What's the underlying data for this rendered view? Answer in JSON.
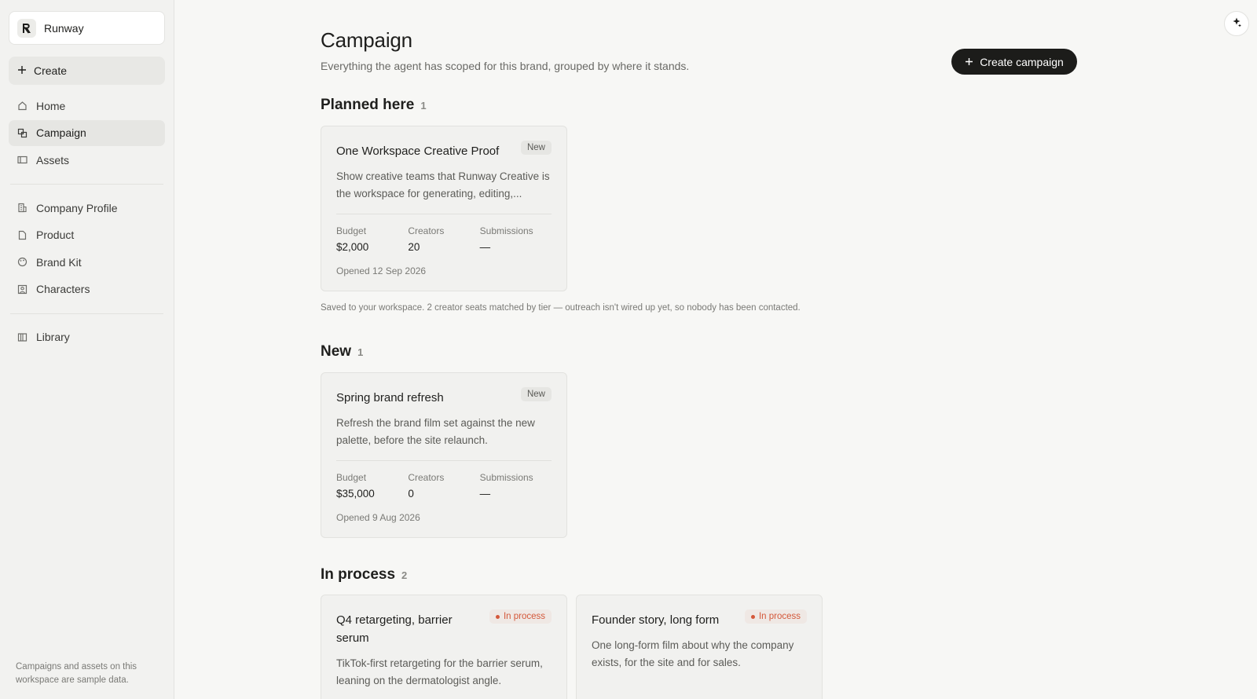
{
  "workspace": {
    "name": "Runway"
  },
  "sidebar": {
    "create_label": "Create",
    "nav_main": [
      {
        "label": "Home",
        "icon": "home-icon",
        "active": false
      },
      {
        "label": "Campaign",
        "icon": "campaign-icon",
        "active": true
      },
      {
        "label": "Assets",
        "icon": "assets-icon",
        "active": false
      }
    ],
    "nav_brand": [
      {
        "label": "Company Profile",
        "icon": "company-icon"
      },
      {
        "label": "Product",
        "icon": "product-icon"
      },
      {
        "label": "Brand Kit",
        "icon": "palette-icon"
      },
      {
        "label": "Characters",
        "icon": "character-icon"
      }
    ],
    "nav_library": [
      {
        "label": "Library",
        "icon": "library-icon"
      }
    ],
    "note": "Campaigns and assets on this workspace are sample data."
  },
  "header": {
    "title": "Campaign",
    "subtitle": "Everything the agent has scoped for this brand, grouped by where it stands.",
    "create_button": "Create campaign"
  },
  "sections": {
    "planned": {
      "title": "Planned here",
      "count": "1",
      "footnote": "Saved to your workspace. 2 creator seats matched by tier — outreach isn't wired up yet, so nobody has been contacted."
    },
    "new": {
      "title": "New",
      "count": "1"
    },
    "in_process": {
      "title": "In process",
      "count": "2"
    }
  },
  "cards": {
    "planned_0": {
      "title": "One Workspace Creative Proof",
      "badge": "New",
      "desc": "Show creative teams that Runway Creative is the workspace for generating, editing,...",
      "budget_label": "Budget",
      "budget": "$2,000",
      "creators_label": "Creators",
      "creators": "20",
      "submissions_label": "Submissions",
      "submissions": "—",
      "opened": "Opened 12 Sep 2026"
    },
    "new_0": {
      "title": "Spring brand refresh",
      "badge": "New",
      "desc": "Refresh the brand film set against the new palette, before the site relaunch.",
      "budget_label": "Budget",
      "budget": "$35,000",
      "creators_label": "Creators",
      "creators": "0",
      "submissions_label": "Submissions",
      "submissions": "—",
      "opened": "Opened 9 Aug 2026"
    },
    "process_0": {
      "title": "Q4 retargeting, barrier serum",
      "badge": "In process",
      "desc": "TikTok-first retargeting for the barrier serum, leaning on the dermatologist angle."
    },
    "process_1": {
      "title": "Founder story, long form",
      "badge": "In process",
      "desc": "One long-form film about why the company exists, for the site and for sales."
    }
  },
  "colors": {
    "accent_dark": "#1c1c1a",
    "status_process": "#d4583a",
    "background": "#f7f7f5"
  }
}
